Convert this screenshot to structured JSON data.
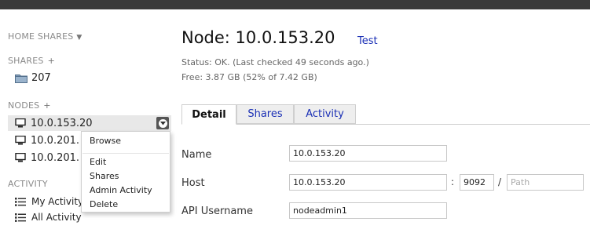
{
  "sidebar": {
    "home_shares": "HOME SHARES",
    "shares_header": "SHARES",
    "shares_plus": "+",
    "shares": [
      {
        "label": "207",
        "icon": "folder-icon"
      }
    ],
    "nodes_header": "NODES",
    "nodes_plus": "+",
    "nodes": [
      {
        "label": "10.0.153.20",
        "icon": "computer-icon"
      },
      {
        "label": "10.0.201.",
        "icon": "computer-icon"
      },
      {
        "label": "10.0.201.",
        "icon": "computer-icon"
      }
    ],
    "activity_header": "ACTIVITY",
    "activity": [
      {
        "label": "My Activity",
        "icon": "list-icon"
      },
      {
        "label": "All Activity",
        "icon": "list-icon"
      }
    ]
  },
  "context_menu": {
    "items": [
      "Browse",
      "Edit",
      "Shares",
      "Admin Activity",
      "Delete"
    ]
  },
  "main": {
    "title": "Node: 10.0.153.20",
    "test_link": "Test",
    "status": "Status: OK. (Last checked 49 seconds ago.)",
    "free": "Free: 3.87 GB (52% of 7.42 GB)",
    "tabs": [
      {
        "label": "Detail",
        "active": true
      },
      {
        "label": "Shares",
        "active": false
      },
      {
        "label": "Activity",
        "active": false
      }
    ],
    "form": {
      "name_label": "Name",
      "name_value": "10.0.153.20",
      "host_label": "Host",
      "host_value": "10.0.153.20",
      "colon": ":",
      "port_value": "9092",
      "slash": "/",
      "path_placeholder": "Path",
      "api_username_label": "API Username",
      "api_username_value": "nodeadmin1"
    }
  },
  "colors": {
    "link": "#1a2fb5",
    "topbar": "#3a3a3a",
    "tab_inactive_bg": "#eeeeee"
  }
}
